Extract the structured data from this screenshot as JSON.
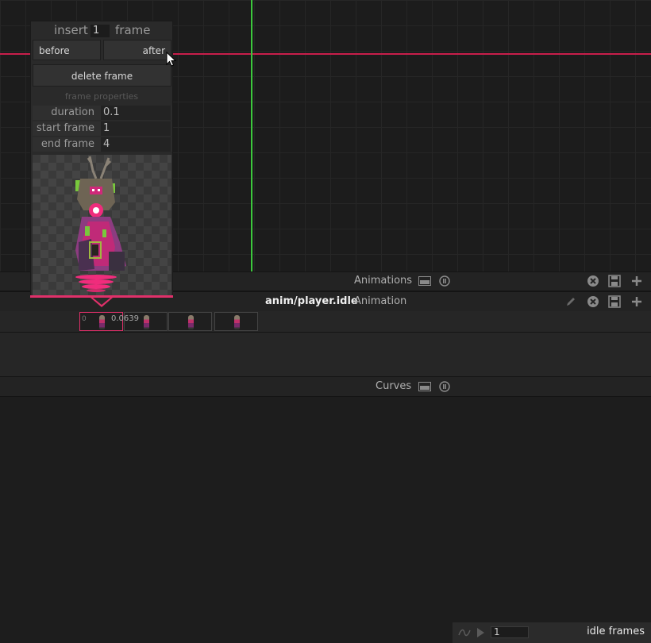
{
  "popup": {
    "insert_label": "insert",
    "insert_count": "1",
    "frame_label": "frame",
    "before_label": "before",
    "after_label": "after",
    "delete_label": "delete frame",
    "frame_properties_title": "frame properties",
    "properties": [
      {
        "label": "duration",
        "value": "0.1"
      },
      {
        "label": "start frame",
        "value": "1"
      },
      {
        "label": "end frame",
        "value": "4"
      }
    ]
  },
  "animations_bar": {
    "title": "Animations"
  },
  "animation_bar": {
    "name": "anim/player.idle",
    "title": "Animation"
  },
  "timeline": {
    "frames": [
      {
        "label": "0",
        "selected": true
      },
      {
        "label": "",
        "selected": false
      },
      {
        "label": "",
        "selected": false
      },
      {
        "label": "",
        "selected": false
      }
    ],
    "duration_label": "0.0639",
    "loop_count": "1",
    "clip_name": "idle frames"
  },
  "curves_bar": {
    "title": "Curves"
  },
  "colors": {
    "accent": "#e0306a",
    "axis_x": "#c81e4b",
    "axis_y": "#3cc83c"
  }
}
